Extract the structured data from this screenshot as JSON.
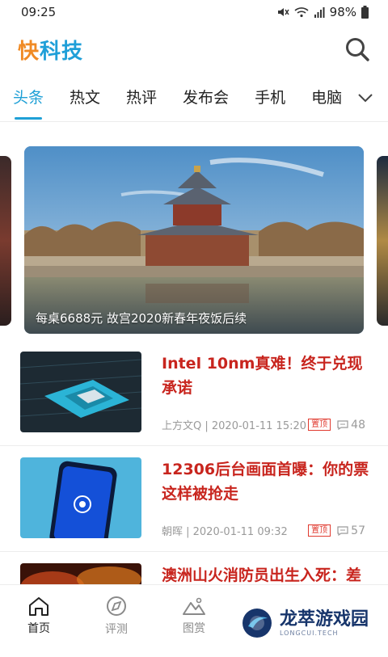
{
  "status_bar": {
    "time": "09:25",
    "battery": "98%"
  },
  "header": {
    "logo_part1": "快",
    "logo_part2": "科技"
  },
  "tabs": [
    {
      "label": "头条",
      "active": true
    },
    {
      "label": "热文"
    },
    {
      "label": "热评"
    },
    {
      "label": "发布会"
    },
    {
      "label": "手机"
    },
    {
      "label": "电脑"
    }
  ],
  "banner": {
    "caption": "每桌6688元 故宫2020新春年夜饭后续"
  },
  "articles": [
    {
      "title": "Intel 10nm真难！终于兑现承诺",
      "meta": "上方文Q | 2020-01-11 15:20",
      "badge": "置顶",
      "comments": "48"
    },
    {
      "title": "12306后台画面首曝：你的票这样被抢走",
      "meta": "朝晖 | 2020-01-11 09:32",
      "badge": "置顶",
      "comments": "57"
    },
    {
      "title": "澳洲山火消防员出生入死：差"
    }
  ],
  "bottom_nav": [
    {
      "label": "首页",
      "active": true
    },
    {
      "label": "评测"
    },
    {
      "label": "图赏"
    },
    {
      "label": ""
    },
    {
      "label": ""
    }
  ],
  "watermark": {
    "main": "龙萃游戏园",
    "sub": "LONGCUI.TECH"
  },
  "colors": {
    "accent": "#1fa0d6",
    "title_red": "#c8251e",
    "logo_orange": "#f08a24",
    "logo_blue": "#1f9fd8"
  }
}
